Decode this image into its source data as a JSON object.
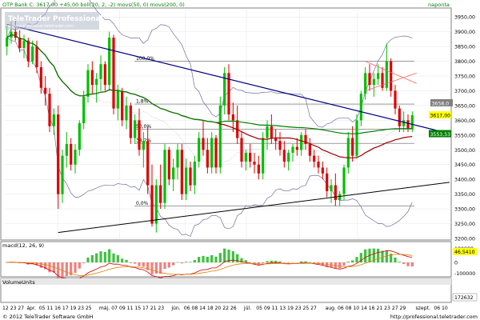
{
  "header": {
    "left": "OTP Bank  C: 3617,00  +45,00  boll(20, 2, -2)  movs(50, 0)  movs(200, 0)",
    "right": "naponta"
  },
  "watermark": {
    "title": "TeleTrader Professional",
    "subtitle": "www.professional.teletrader.com"
  },
  "fib_levels": [
    "100,0%",
    "1,8%",
    "50,0%",
    "38,2%",
    "0,0%"
  ],
  "price_axis": {
    "ticks": [
      "3950,00",
      "3900,00",
      "3850,00",
      "3800,00",
      "3750,00",
      "3700,00",
      "3650,00",
      "3600,00",
      "3550,00",
      "3500,00",
      "3450,00",
      "3400,00",
      "3350,00",
      "3300,00",
      "3250,00",
      "3200,00"
    ],
    "badges": [
      {
        "label": "3658,0",
        "bg": "#808080",
        "fg": "#ffffff"
      },
      {
        "label": "3617,00",
        "bg": "#ffff00",
        "fg": "#000000"
      },
      {
        "label": "3553,53",
        "bg": "#008000",
        "fg": "#ffffff"
      }
    ]
  },
  "macd": {
    "label": "macd(12, 26, 9)",
    "ticks": [
      "100000",
      "0",
      "-100000"
    ],
    "badge": "46,5410"
  },
  "volume": {
    "label": "VolumeUnits",
    "badge": "172632"
  },
  "x_axis": {
    "labels": [
      "12 23 27",
      "ápr.",
      "05 11 16 17 19 23 25",
      "máj.",
      "07 09 11 15 17 21 23",
      "jún.",
      "06 08 14 18 20 22 26",
      "júl.",
      "05 09 11 13 19 23 25 27",
      "aug.",
      "06 08 10 14 16 21 23 27 29",
      "szept.",
      "06 10"
    ]
  },
  "footer": {
    "left": "© 2012 TeleTrader Software GmbH",
    "right": "http://professional.teletrader.com"
  },
  "colors": {
    "up": "#00c000",
    "down": "#e00000",
    "boll": "#7070a0",
    "ma50": "#a00000",
    "ma200": "#008000",
    "trend_blue": "#000080",
    "trend_black": "#000000",
    "fib": "#606060",
    "signal": "#e08000",
    "macd": "#d00000"
  },
  "chart_data": {
    "type": "candlestick",
    "ylim": [
      3200,
      3975
    ],
    "ohlc": [
      [
        3850,
        3920,
        3820,
        3880
      ],
      [
        3880,
        3935,
        3860,
        3900
      ],
      [
        3900,
        3945,
        3870,
        3880
      ],
      [
        3880,
        3905,
        3830,
        3845
      ],
      [
        3845,
        3890,
        3810,
        3870
      ],
      [
        3870,
        3880,
        3780,
        3800
      ],
      [
        3800,
        3870,
        3790,
        3850
      ],
      [
        3850,
        3870,
        3760,
        3780
      ],
      [
        3780,
        3800,
        3690,
        3710
      ],
      [
        3710,
        3750,
        3650,
        3690
      ],
      [
        3690,
        3710,
        3560,
        3580
      ],
      [
        3580,
        3640,
        3550,
        3620
      ],
      [
        3620,
        3650,
        3300,
        3350
      ],
      [
        3350,
        3500,
        3320,
        3480
      ],
      [
        3480,
        3560,
        3440,
        3520
      ],
      [
        3520,
        3540,
        3430,
        3450
      ],
      [
        3450,
        3520,
        3420,
        3500
      ],
      [
        3500,
        3600,
        3480,
        3590
      ],
      [
        3590,
        3700,
        3570,
        3680
      ],
      [
        3680,
        3790,
        3660,
        3770
      ],
      [
        3770,
        3800,
        3690,
        3720
      ],
      [
        3720,
        3760,
        3660,
        3740
      ],
      [
        3740,
        3820,
        3700,
        3790
      ],
      [
        3790,
        3800,
        3700,
        3720
      ],
      [
        3720,
        3900,
        3700,
        3880
      ],
      [
        3880,
        3890,
        3620,
        3640
      ],
      [
        3640,
        3720,
        3600,
        3700
      ],
      [
        3700,
        3710,
        3580,
        3600
      ],
      [
        3600,
        3680,
        3570,
        3650
      ],
      [
        3650,
        3660,
        3520,
        3540
      ],
      [
        3540,
        3620,
        3520,
        3600
      ],
      [
        3600,
        3640,
        3480,
        3500
      ],
      [
        3500,
        3560,
        3440,
        3530
      ],
      [
        3530,
        3580,
        3350,
        3380
      ],
      [
        3380,
        3450,
        3240,
        3250
      ],
      [
        3250,
        3400,
        3220,
        3380
      ],
      [
        3380,
        3450,
        3300,
        3320
      ],
      [
        3320,
        3520,
        3300,
        3500
      ],
      [
        3500,
        3510,
        3380,
        3400
      ],
      [
        3400,
        3470,
        3360,
        3440
      ],
      [
        3440,
        3520,
        3400,
        3500
      ],
      [
        3500,
        3520,
        3330,
        3350
      ],
      [
        3350,
        3470,
        3330,
        3440
      ],
      [
        3440,
        3460,
        3360,
        3380
      ],
      [
        3380,
        3480,
        3350,
        3460
      ],
      [
        3460,
        3560,
        3440,
        3540
      ],
      [
        3540,
        3600,
        3480,
        3500
      ],
      [
        3500,
        3540,
        3420,
        3440
      ],
      [
        3440,
        3560,
        3420,
        3540
      ],
      [
        3540,
        3550,
        3420,
        3440
      ],
      [
        3440,
        3680,
        3420,
        3650
      ],
      [
        3650,
        3780,
        3620,
        3760
      ],
      [
        3760,
        3790,
        3600,
        3620
      ],
      [
        3620,
        3660,
        3560,
        3600
      ],
      [
        3600,
        3650,
        3520,
        3540
      ],
      [
        3540,
        3560,
        3440,
        3460
      ],
      [
        3460,
        3500,
        3430,
        3490
      ],
      [
        3490,
        3520,
        3440,
        3460
      ],
      [
        3460,
        3490,
        3420,
        3450
      ],
      [
        3450,
        3480,
        3400,
        3420
      ],
      [
        3420,
        3560,
        3400,
        3540
      ],
      [
        3540,
        3600,
        3500,
        3580
      ],
      [
        3580,
        3620,
        3520,
        3540
      ],
      [
        3540,
        3570,
        3500,
        3530
      ],
      [
        3530,
        3560,
        3480,
        3500
      ],
      [
        3500,
        3530,
        3440,
        3460
      ],
      [
        3460,
        3500,
        3430,
        3490
      ],
      [
        3490,
        3520,
        3460,
        3510
      ],
      [
        3510,
        3540,
        3480,
        3500
      ],
      [
        3500,
        3560,
        3480,
        3550
      ],
      [
        3550,
        3570,
        3500,
        3520
      ],
      [
        3520,
        3540,
        3460,
        3480
      ],
      [
        3480,
        3500,
        3440,
        3460
      ],
      [
        3460,
        3480,
        3420,
        3440
      ],
      [
        3440,
        3460,
        3400,
        3420
      ],
      [
        3420,
        3440,
        3340,
        3360
      ],
      [
        3360,
        3400,
        3320,
        3380
      ],
      [
        3380,
        3420,
        3310,
        3330
      ],
      [
        3330,
        3360,
        3310,
        3350
      ],
      [
        3350,
        3450,
        3330,
        3440
      ],
      [
        3440,
        3560,
        3420,
        3540
      ],
      [
        3540,
        3580,
        3460,
        3480
      ],
      [
        3480,
        3620,
        3470,
        3600
      ],
      [
        3600,
        3700,
        3580,
        3690
      ],
      [
        3690,
        3780,
        3670,
        3760
      ],
      [
        3760,
        3790,
        3700,
        3720
      ],
      [
        3720,
        3760,
        3680,
        3740
      ],
      [
        3740,
        3790,
        3720,
        3760
      ],
      [
        3760,
        3780,
        3700,
        3710
      ],
      [
        3710,
        3860,
        3700,
        3800
      ],
      [
        3800,
        3810,
        3680,
        3700
      ],
      [
        3700,
        3720,
        3620,
        3640
      ],
      [
        3640,
        3650,
        3560,
        3580
      ],
      [
        3580,
        3630,
        3560,
        3600
      ],
      [
        3600,
        3620,
        3560,
        3572
      ],
      [
        3572,
        3630,
        3560,
        3617
      ]
    ],
    "fib_values": [
      3800,
      3655,
      3570,
      3522,
      3310
    ],
    "trendline_blue": [
      [
        0,
        3925
      ],
      [
        97,
        3555
      ]
    ],
    "trendline_black": [
      [
        12,
        3220
      ],
      [
        97,
        3390
      ]
    ]
  }
}
